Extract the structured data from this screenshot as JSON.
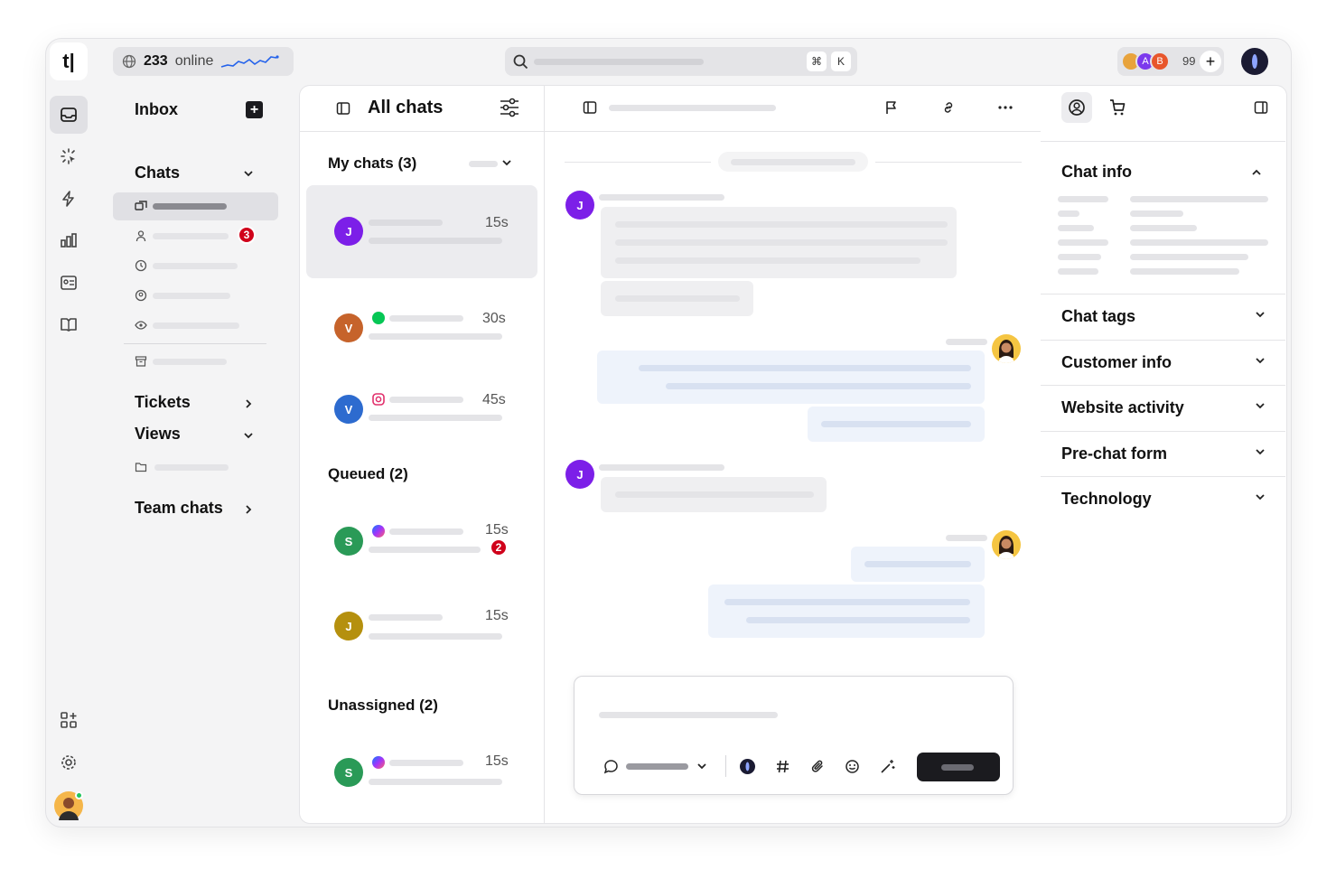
{
  "topbar": {
    "logo": "t|",
    "online_count": "233",
    "online_label": "online",
    "search_shortcut": [
      "⌘",
      "K"
    ],
    "agents_count": "99",
    "agent_initials": [
      "A",
      "B"
    ]
  },
  "rail": {
    "icons": [
      "inbox-icon",
      "sparkle-icon",
      "bolt-icon",
      "chart-icon",
      "contacts-icon",
      "book-icon",
      "apps-icon",
      "settings-icon"
    ]
  },
  "nav": {
    "inbox": "Inbox",
    "chats": "Chats",
    "my_badge": "3",
    "tickets": "Tickets",
    "views": "Views",
    "team_chats": "Team chats"
  },
  "chat_list": {
    "title": "All chats",
    "sections": {
      "mine": "My chats (3)",
      "queued": "Queued (2)",
      "unassigned": "Unassigned (2)"
    },
    "chats": [
      {
        "initial": "J",
        "color": "#7c1fe8",
        "time": "15s",
        "channel": "none"
      },
      {
        "initial": "V",
        "color": "#c6632b",
        "time": "30s",
        "channel": "line"
      },
      {
        "initial": "V",
        "color": "#2d6bcf",
        "time": "45s",
        "channel": "instagram"
      },
      {
        "initial": "S",
        "color": "#2a9a57",
        "time": "15s",
        "channel": "messenger",
        "badge": "2"
      },
      {
        "initial": "J",
        "color": "#b5900e",
        "time": "15s",
        "channel": "none"
      },
      {
        "initial": "S",
        "color": "#2a9a57",
        "time": "15s",
        "channel": "messenger"
      }
    ]
  },
  "conversation": {
    "customer_initial": "J",
    "customer_color": "#7c1fe8"
  },
  "details": {
    "chat_info": "Chat info",
    "sections": [
      "Chat tags",
      "Customer info",
      "Website activity",
      "Pre-chat form",
      "Technology"
    ]
  },
  "colors": {
    "badge_red": "#d0021b",
    "send_button": "#1b1b1f",
    "online_spark": "#2563eb"
  }
}
